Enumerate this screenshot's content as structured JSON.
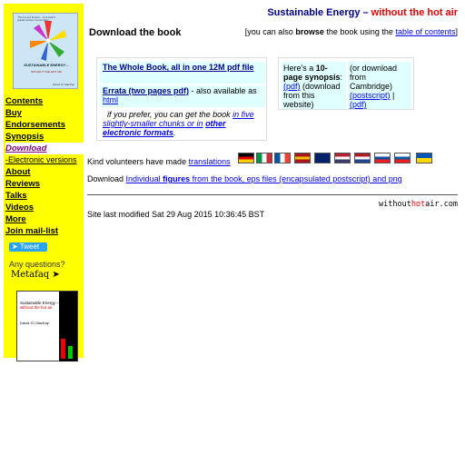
{
  "header": {
    "site_title": "Sustainable Energy –",
    "site_tagline": "without the hot air",
    "page_title": "Download the book",
    "browse_prefix": "[you can also",
    "browse_word": "browse",
    "browse_middle": "the book using the",
    "browse_link": "table of contents",
    "browse_suffix": "]"
  },
  "cover": {
    "blurb": "\"This is a tour de force… As a work of popular science it is exemplary.\"",
    "title": "SUSTAINABLE ENERGY –",
    "subtitle": "WITHOUT THE HOT AIR",
    "author": "David JC MacKay"
  },
  "sidebar": {
    "items": [
      {
        "label": "Contents"
      },
      {
        "label": "Buy"
      },
      {
        "label": "Endorsements"
      },
      {
        "label": "Synopsis"
      },
      {
        "label": "Download"
      },
      {
        "label": "-Electronic versions"
      },
      {
        "label": "About"
      },
      {
        "label": "Reviews"
      },
      {
        "label": "Talks"
      },
      {
        "label": "Videos"
      },
      {
        "label": "More"
      },
      {
        "label": "Join mail-list"
      }
    ],
    "tweet_label": "Tweet",
    "questions": "Any questions?",
    "metafaq": "Metafaq",
    "mini_cover": {
      "title": "Sustainable Energy –",
      "tagline": "without the hot air",
      "author": "David JC MacKay"
    }
  },
  "downloads": {
    "whole_book": "The Whole Book, all in one 12M pdf file",
    "errata": "Errata (two pages pdf)",
    "errata_mid": "- also available as",
    "errata_html": "html",
    "prefer_text": "if you prefer, you can get the book",
    "prefer_link": "in five slightly-smaller chunks or in",
    "prefer_other": "other electronic formats",
    "prefer_end": "."
  },
  "synopsis_box": {
    "heres": "Here's a",
    "ten_page": "10-page synopsis",
    "colon": ":",
    "pdf": "(pdf)",
    "download_from_site": "(download from this website)",
    "or_cambridge": "(or download from Cambridge)",
    "postscript": "(postscript)",
    "bar": "|",
    "pdf2": "(pdf)"
  },
  "translations": {
    "text": "Kind volunteers have made",
    "link": "translations",
    "flags": [
      {
        "name": "germany",
        "colors": [
          "#000000",
          "#dd0000",
          "#ffce00"
        ],
        "dir": "h"
      },
      {
        "name": "italy",
        "colors": [
          "#009246",
          "#ffffff",
          "#ce2b37"
        ],
        "dir": "v"
      },
      {
        "name": "france",
        "colors": [
          "#0055a4",
          "#ffffff",
          "#ef4135"
        ],
        "dir": "v"
      },
      {
        "name": "spain",
        "colors": [
          "#aa151b",
          "#f1bf00",
          "#aa151b"
        ],
        "dir": "h"
      },
      {
        "name": "australia",
        "colors": [
          "#012169",
          "#012169",
          "#012169"
        ],
        "dir": "h"
      },
      {
        "name": "usa",
        "colors": [
          "#b22234",
          "#ffffff",
          "#3c3b6e"
        ],
        "dir": "h"
      },
      {
        "name": "netherlands",
        "colors": [
          "#ae1c28",
          "#ffffff",
          "#21468b"
        ],
        "dir": "h"
      },
      {
        "name": "slovakia",
        "colors": [
          "#ffffff",
          "#0b4ea2",
          "#ee1c25"
        ],
        "dir": "h"
      },
      {
        "name": "slovenia",
        "colors": [
          "#ffffff",
          "#005da4",
          "#ed1c24"
        ],
        "dir": "h"
      },
      {
        "name": "ukraine",
        "colors": [
          "#0057b7",
          "#ffd700"
        ],
        "dir": "h"
      }
    ]
  },
  "figures": {
    "prefix": "Download",
    "link_a": "Individual",
    "link_b": "figures",
    "link_c": "from the book, eps files (encapsulated postscript) and png"
  },
  "footer": {
    "brand_a": "without",
    "brand_hot": "hot",
    "brand_b": "air.com",
    "modified": "Site last modified Sat 29 Aug 2015 10:36:45 BST"
  }
}
